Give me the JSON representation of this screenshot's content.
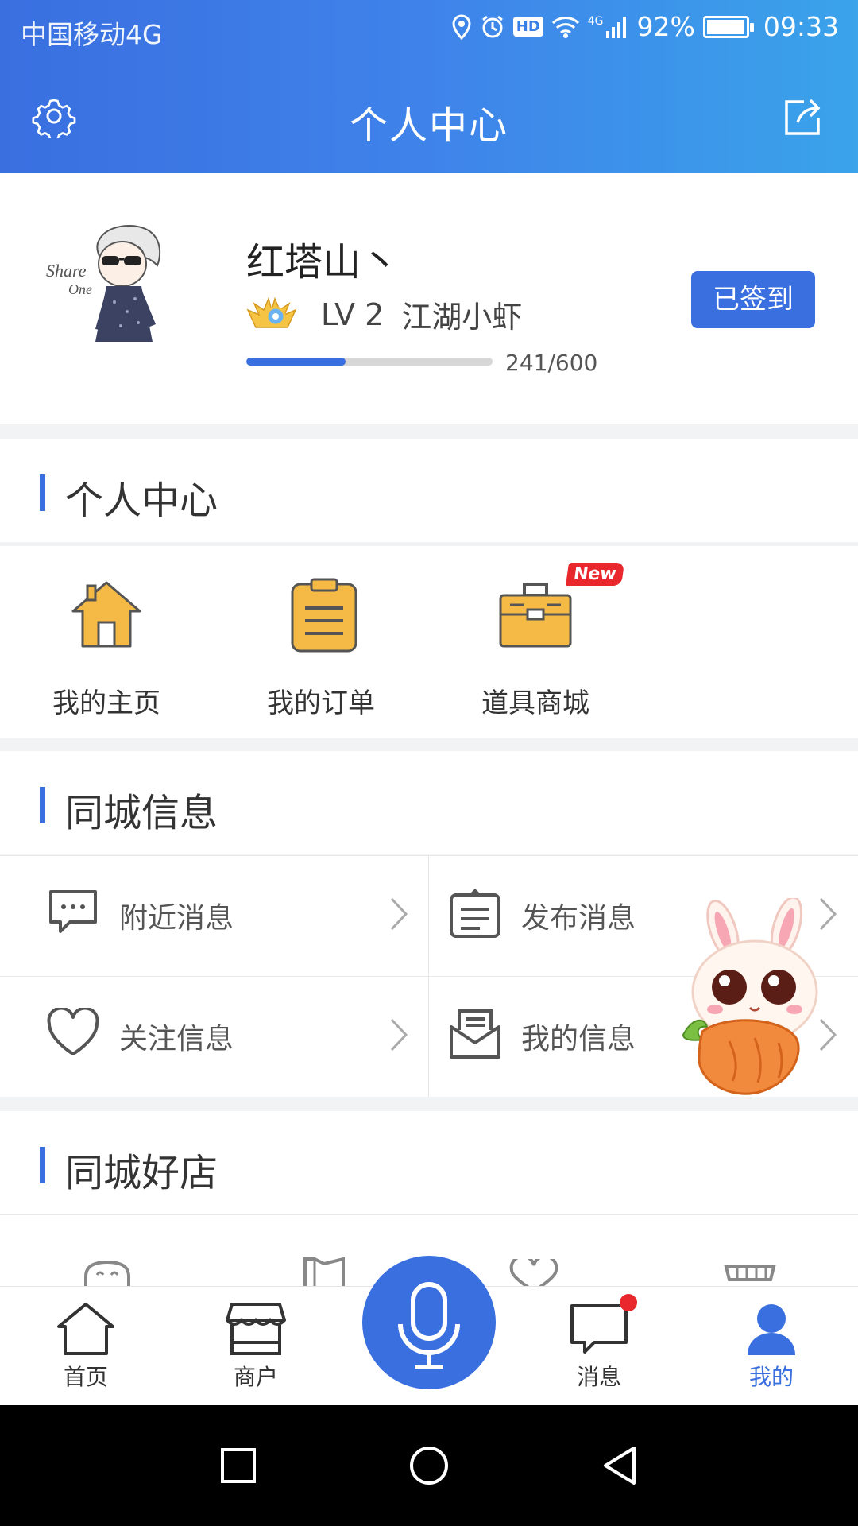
{
  "status_bar": {
    "carrier": "中国移动4G",
    "network_badge": "4G",
    "hd_badge": "HD",
    "battery": "92%",
    "time": "09:33"
  },
  "header": {
    "title": "个人中心",
    "settings_icon": "gear-icon",
    "share_icon": "share-icon"
  },
  "profile": {
    "username": "红塔山丶",
    "level": "LV 2",
    "level_title": "江湖小虾",
    "progress_text": "241/600",
    "progress_fraction": 0.4017,
    "sign_button": "已签到",
    "avatar_caption_1": "Share",
    "avatar_caption_2": "One"
  },
  "section_personal": {
    "title": "个人中心",
    "items": [
      {
        "label": "我的主页",
        "icon": "house-icon"
      },
      {
        "label": "我的订单",
        "icon": "clipboard-icon"
      },
      {
        "label": "道具商城",
        "icon": "toolbox-icon",
        "badge": "New"
      }
    ]
  },
  "section_city": {
    "title": "同城信息",
    "items": [
      {
        "label": "附近消息",
        "icon": "chat-bubble-icon"
      },
      {
        "label": "发布消息",
        "icon": "publish-icon"
      },
      {
        "label": "关注信息",
        "icon": "heart-icon"
      },
      {
        "label": "我的信息",
        "icon": "mail-icon"
      }
    ]
  },
  "section_shops": {
    "title": "同城好店"
  },
  "tabbar": {
    "tabs": [
      {
        "label": "首页",
        "icon": "home-icon"
      },
      {
        "label": "商户",
        "icon": "store-icon"
      },
      {
        "label": "消息",
        "icon": "message-icon"
      },
      {
        "label": "我的",
        "icon": "user-icon"
      }
    ],
    "center_icon": "microphone-icon"
  },
  "colors": {
    "accent": "#3a6fe0",
    "icon_orange": "#f5b945",
    "badge_red": "#e8282d"
  }
}
